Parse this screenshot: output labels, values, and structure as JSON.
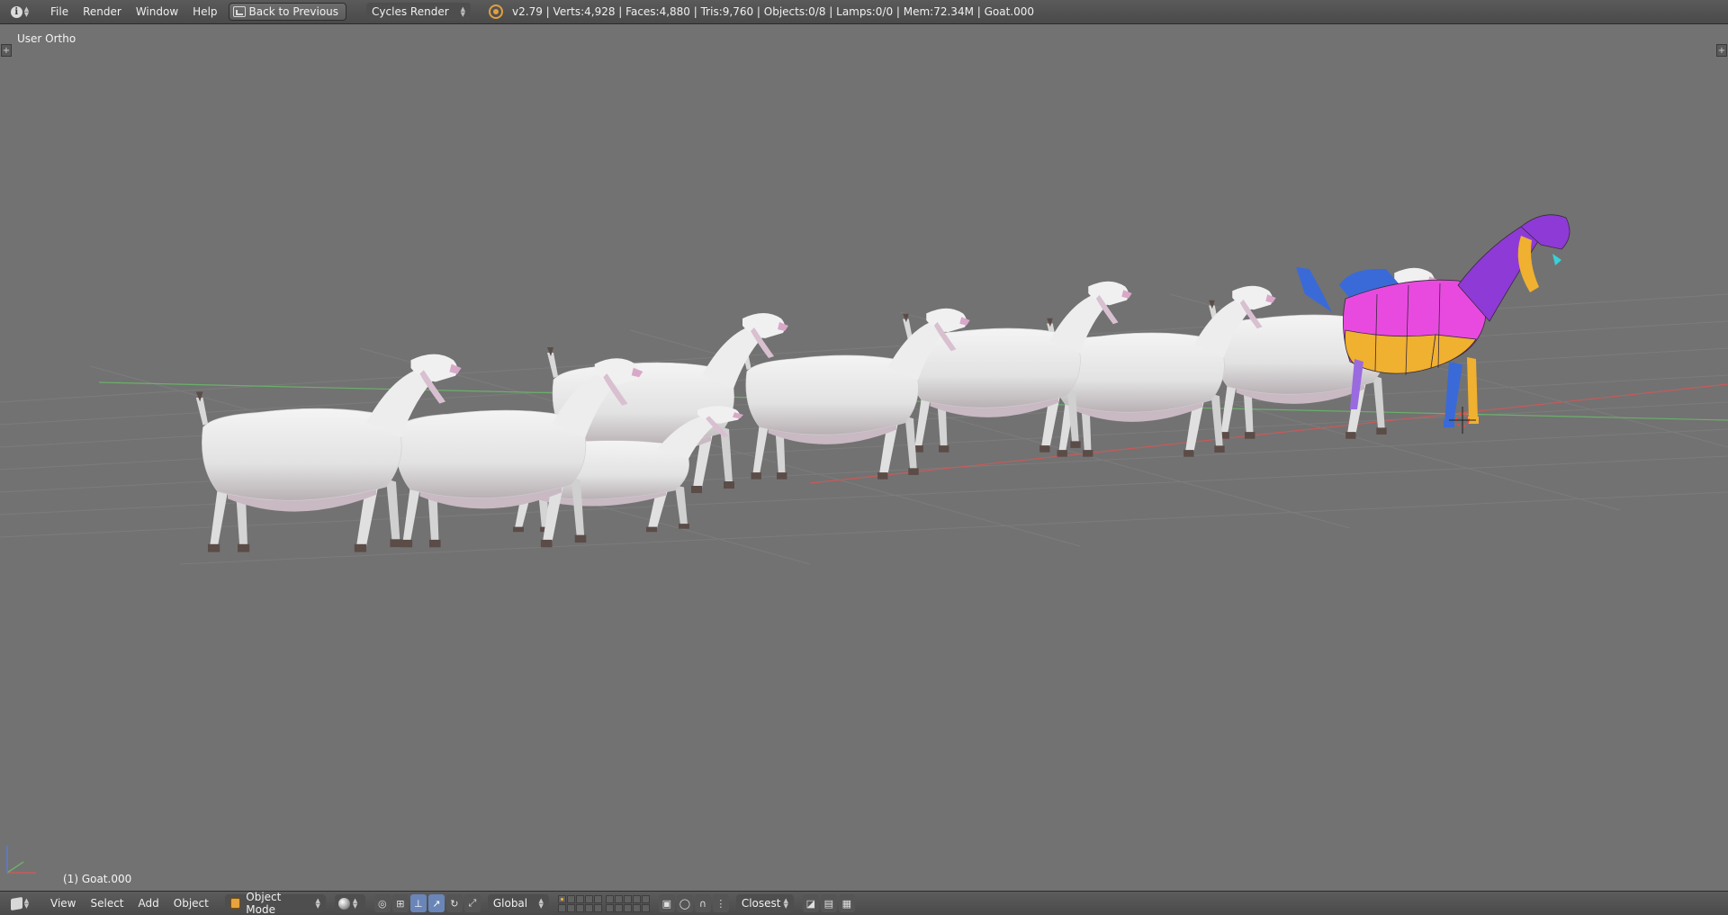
{
  "top_header": {
    "menus": [
      "File",
      "Render",
      "Window",
      "Help"
    ],
    "back_button": "Back to Previous",
    "render_engine": "Cycles Render",
    "stats": "v2.79 | Verts:4,928 | Faces:4,880 | Tris:9,760 | Objects:0/8 | Lamps:0/0 | Mem:72.34M | Goat.000"
  },
  "viewport": {
    "view_label": "User Ortho",
    "object_label": "(1) Goat.000",
    "background_color": "#727272",
    "side_tab_left": "+",
    "side_tab_right": "+"
  },
  "bottom_header": {
    "menus": [
      "View",
      "Select",
      "Add",
      "Object"
    ],
    "mode": "Object Mode",
    "transform_orientation": "Global",
    "snap_target": "Closest"
  },
  "icons": {
    "editor_type": "info-icon",
    "render_engine": "cycles-render-icon",
    "mode": "object-mode-cube-icon",
    "shading": "solid-shading-ball-icon"
  },
  "colors": {
    "uv_magenta": "#e84ae0",
    "uv_yellow": "#f0b030",
    "uv_blue": "#3a6ad8",
    "uv_purple": "#8e3ad6",
    "goat_white": "#ececec",
    "goat_hoof": "#5b4c48",
    "x_axis": "#c85a5a",
    "y_axis": "#6ab06a"
  }
}
